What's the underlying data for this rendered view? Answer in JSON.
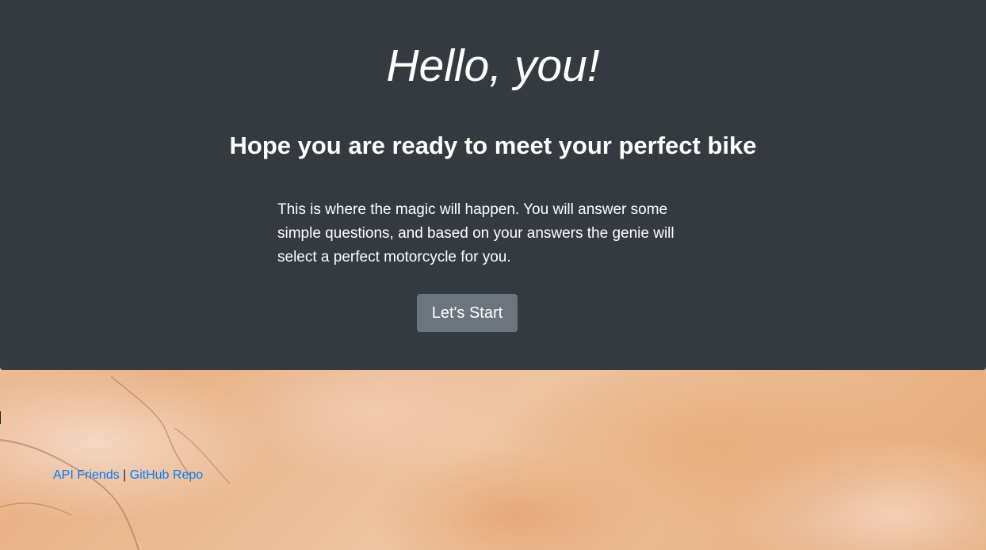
{
  "hero": {
    "title": "Hello, you!",
    "subtitle": "Hope you are ready to meet your perfect bike",
    "description": "This is where the magic will happen. You will answer some simple questions, and based on your answers the genie will select a perfect motorcycle for you.",
    "start_button_label": "Let's Start"
  },
  "footer": {
    "links": [
      {
        "label": "API Friends"
      },
      {
        "label": "GitHub Repo"
      }
    ],
    "separator": "|"
  },
  "colors": {
    "hero_background": "#343a40",
    "button_background": "#6c757d",
    "link": "#007bff"
  }
}
